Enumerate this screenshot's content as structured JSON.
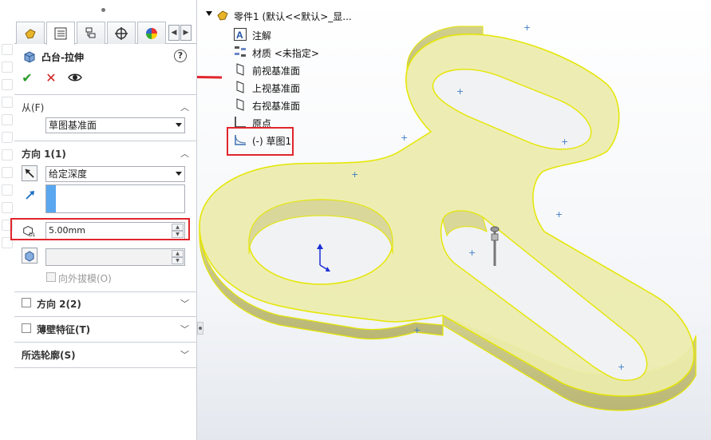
{
  "feature": {
    "title": "凸台-拉伸",
    "help_label": "?",
    "ok_label": "✔",
    "cancel_label": "✕",
    "preview_icon": "eye-icon"
  },
  "tabs": [
    {
      "name": "feature-manager",
      "icon": "part-icon"
    },
    {
      "name": "property-manager",
      "icon": "list-icon"
    },
    {
      "name": "configuration-manager",
      "icon": "config-icon"
    },
    {
      "name": "dimxpert-manager",
      "icon": "crosshair-icon"
    },
    {
      "name": "display-manager",
      "icon": "color-wheel-icon"
    }
  ],
  "from": {
    "title": "从(F)",
    "value": "草图基准面"
  },
  "direction1": {
    "title": "方向 1(1)",
    "end_condition": "给定深度",
    "depth": "5.00mm",
    "draft_outward_label": "向外拔模(O)",
    "depth_badge": "D1"
  },
  "direction2": {
    "title": "方向 2(2)"
  },
  "thin_feature": {
    "title": "薄壁特征(T)"
  },
  "selected_contours": {
    "title": "所选轮廓(S)"
  },
  "tree": {
    "root": "零件1  (默认<<默认>_显...",
    "items": [
      {
        "label": "注解",
        "icon": "annotation-icon"
      },
      {
        "label": "材质 <未指定>",
        "icon": "material-icon"
      },
      {
        "label": "前视基准面",
        "icon": "plane-icon"
      },
      {
        "label": "上视基准面",
        "icon": "plane-icon"
      },
      {
        "label": "右视基准面",
        "icon": "plane-icon"
      },
      {
        "label": "原点",
        "icon": "origin-icon"
      },
      {
        "label": "(-) 草图1",
        "icon": "sketch-icon"
      }
    ]
  },
  "colors": {
    "highlight": "#e0262c",
    "model_fill": "#ecebad",
    "model_edge": "#e5e600",
    "ok_green": "#2a9b2a",
    "cancel_red": "#d21f1f",
    "direction_bar": "#5aa7f0"
  }
}
